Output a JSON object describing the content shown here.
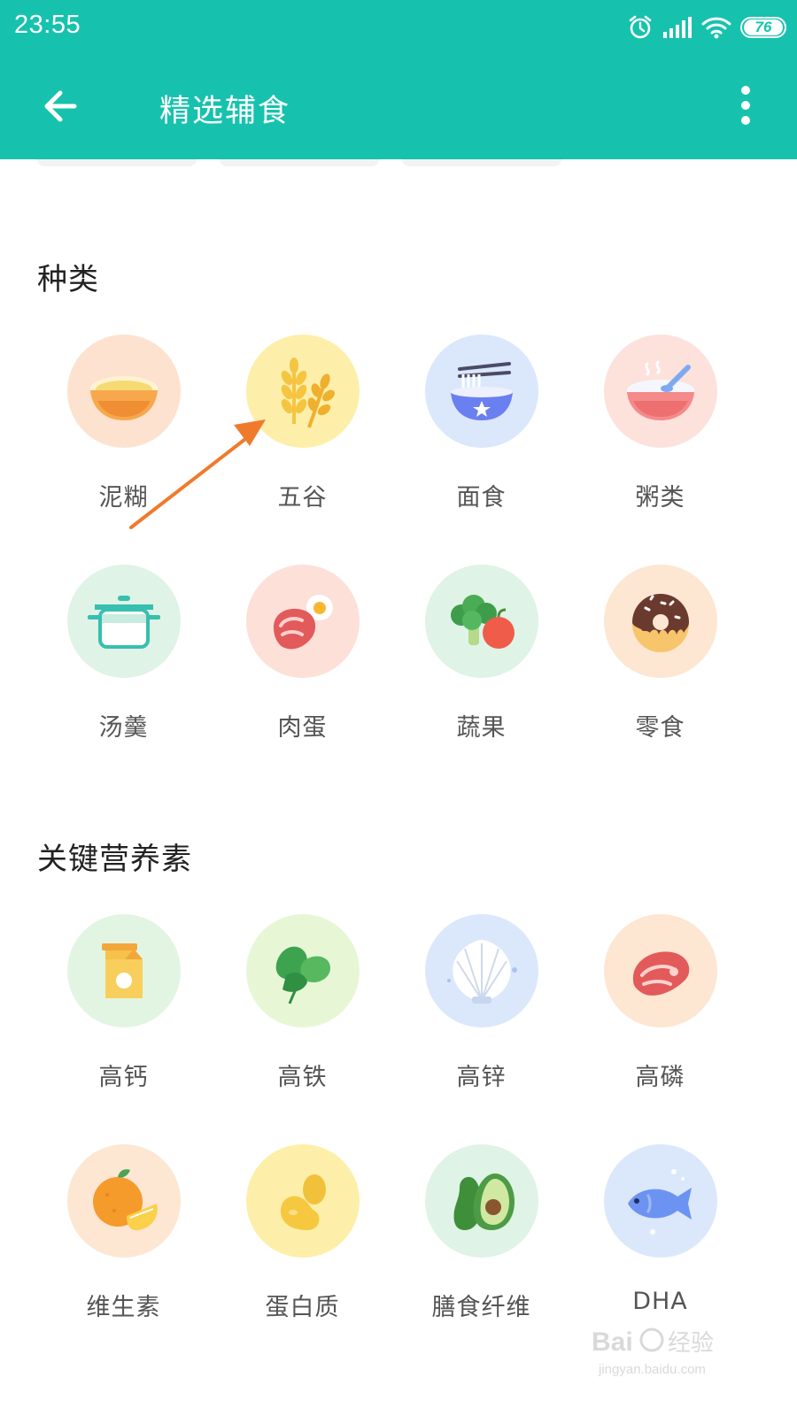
{
  "status_bar": {
    "time": "23:55",
    "battery": "76",
    "icons": [
      "alarm-icon",
      "signal-icon",
      "wifi-icon",
      "battery-icon"
    ]
  },
  "app_bar": {
    "title": "精选辅食",
    "back_icon": "arrow-left-icon",
    "more_icon": "more-vertical-icon"
  },
  "categories": {
    "title": "种类",
    "items": [
      {
        "label": "泥糊",
        "icon": "puree-bowl-icon",
        "bg": "#fde2cf"
      },
      {
        "label": "五谷",
        "icon": "wheat-icon",
        "bg": "#fdefa9"
      },
      {
        "label": "面食",
        "icon": "noodle-bowl-icon",
        "bg": "#dbe8fb"
      },
      {
        "label": "粥类",
        "icon": "porridge-bowl-icon",
        "bg": "#fde2dc"
      },
      {
        "label": "汤羹",
        "icon": "soup-pot-icon",
        "bg": "#dff3e6"
      },
      {
        "label": "肉蛋",
        "icon": "meat-egg-icon",
        "bg": "#fde0d8"
      },
      {
        "label": "蔬果",
        "icon": "broccoli-apple-icon",
        "bg": "#dff3e6"
      },
      {
        "label": "零食",
        "icon": "donut-icon",
        "bg": "#fde6d2"
      }
    ]
  },
  "nutrients": {
    "title": "关键营养素",
    "items": [
      {
        "label": "高钙",
        "icon": "milk-carton-icon",
        "bg": "#e2f5e3"
      },
      {
        "label": "高铁",
        "icon": "spinach-icon",
        "bg": "#e7f7d6"
      },
      {
        "label": "高锌",
        "icon": "shell-icon",
        "bg": "#dbe8fb"
      },
      {
        "label": "高磷",
        "icon": "steak-icon",
        "bg": "#fde6d2"
      },
      {
        "label": "维生素",
        "icon": "orange-icon",
        "bg": "#fde6d2"
      },
      {
        "label": "蛋白质",
        "icon": "beans-icon",
        "bg": "#fdefa9"
      },
      {
        "label": "膳食纤维",
        "icon": "avocado-icon",
        "bg": "#dff3e6"
      },
      {
        "label": "DHA",
        "icon": "fish-icon",
        "bg": "#dbe8fb"
      }
    ]
  },
  "annotation": {
    "icon": "orange-arrow-icon",
    "color": "#f07a2c"
  },
  "watermark": {
    "text": "Bai 经验",
    "sub": "jingyan.baidu.com"
  }
}
